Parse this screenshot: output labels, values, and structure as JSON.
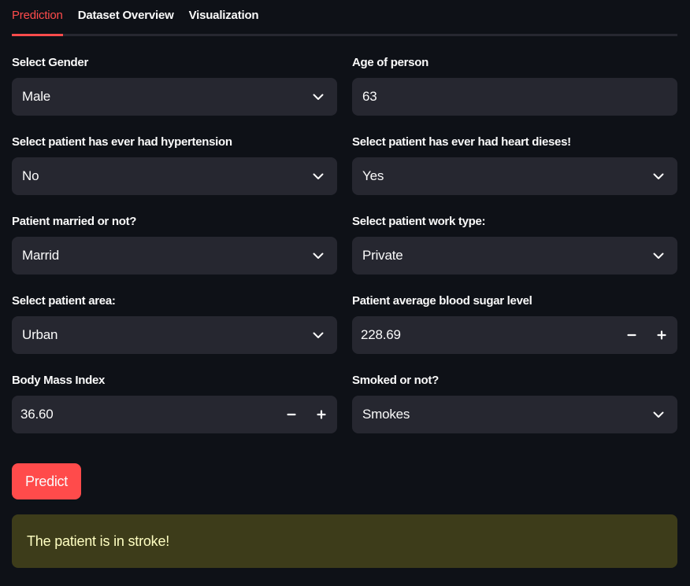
{
  "tabs": [
    {
      "label": "Prediction",
      "active": true
    },
    {
      "label": "Dataset Overview",
      "active": false
    },
    {
      "label": "Visualization",
      "active": false
    }
  ],
  "form": {
    "gender": {
      "label": "Select Gender",
      "value": "Male"
    },
    "age": {
      "label": "Age of person",
      "value": "63"
    },
    "hypertension": {
      "label": "Select patient has ever had hypertension",
      "value": "No"
    },
    "heart_disease": {
      "label": "Select patient has ever had heart dieses!",
      "value": "Yes"
    },
    "married": {
      "label": "Patient married or not?",
      "value": "Marrid"
    },
    "work_type": {
      "label": "Select patient work type:",
      "value": "Private"
    },
    "area": {
      "label": "Select patient area:",
      "value": "Urban"
    },
    "glucose": {
      "label": "Patient average blood sugar level",
      "value": "228.69"
    },
    "bmi": {
      "label": "Body Mass Index",
      "value": "36.60"
    },
    "smoking": {
      "label": "Smoked or not?",
      "value": "Smokes"
    }
  },
  "predict_button": {
    "label": "Predict"
  },
  "result": {
    "message": "The patient is in stroke!"
  },
  "colors": {
    "background": "#0e1117",
    "widget": "#262730",
    "accent": "#ff4b4b",
    "alert_bg": "#3d3c1a",
    "alert_text": "#ffffc2"
  },
  "icons": {
    "select_arrow": "chevron-down-icon",
    "decrement": "minus-icon",
    "increment": "plus-icon"
  }
}
